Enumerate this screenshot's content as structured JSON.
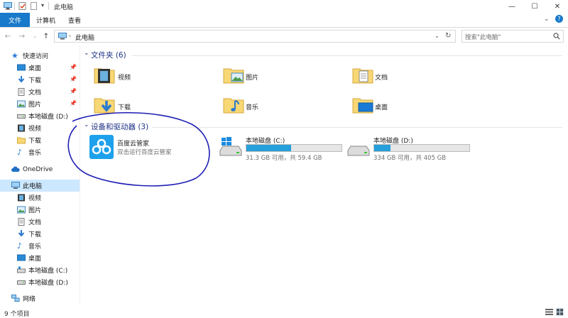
{
  "window": {
    "title": "此电脑",
    "minimize_glyph": "—",
    "maximize_glyph": "☐",
    "close_glyph": "✕"
  },
  "ribbon": {
    "file_tab": "文件",
    "tabs": [
      "计算机",
      "查看"
    ],
    "help_glyph": "?"
  },
  "address": {
    "path": "此电脑",
    "search_placeholder": "搜索\"此电脑\""
  },
  "nav": {
    "quick_access": "快速访问",
    "quick_items": [
      {
        "label": "桌面",
        "pinned": true
      },
      {
        "label": "下载",
        "pinned": true
      },
      {
        "label": "文档",
        "pinned": true
      },
      {
        "label": "图片",
        "pinned": true
      },
      {
        "label": "本地磁盘 (D:)",
        "pinned": false
      },
      {
        "label": "视频",
        "pinned": false
      },
      {
        "label": "下载",
        "pinned": false
      },
      {
        "label": "音乐",
        "pinned": false
      }
    ],
    "onedrive": "OneDrive",
    "this_pc": "此电脑",
    "pc_items": [
      "视频",
      "图片",
      "文档",
      "下载",
      "音乐",
      "桌面",
      "本地磁盘 (C:)",
      "本地磁盘 (D:)"
    ],
    "network": "网络"
  },
  "folders_group": {
    "title": "文件夹 (6)",
    "items": [
      "视频",
      "图片",
      "文档",
      "下载",
      "音乐",
      "桌面"
    ]
  },
  "devices_group": {
    "title": "设备和驱动器 (3)",
    "app": {
      "name": "百度云管家",
      "subtitle": "双击运行百度云管家"
    },
    "drives": [
      {
        "name": "本地磁盘 (C:)",
        "info": "31.3 GB 可用，共 59.4 GB",
        "used_fraction": 0.473
      },
      {
        "name": "本地磁盘 (D:)",
        "info": "334 GB 可用，共 405 GB",
        "used_fraction": 0.175
      }
    ]
  },
  "status": {
    "count": "9 个项目"
  },
  "colors": {
    "accent": "#1979ca",
    "annotation": "#1f1fb4",
    "bar_fill": "#26a0da",
    "folder": "#f8d775"
  }
}
